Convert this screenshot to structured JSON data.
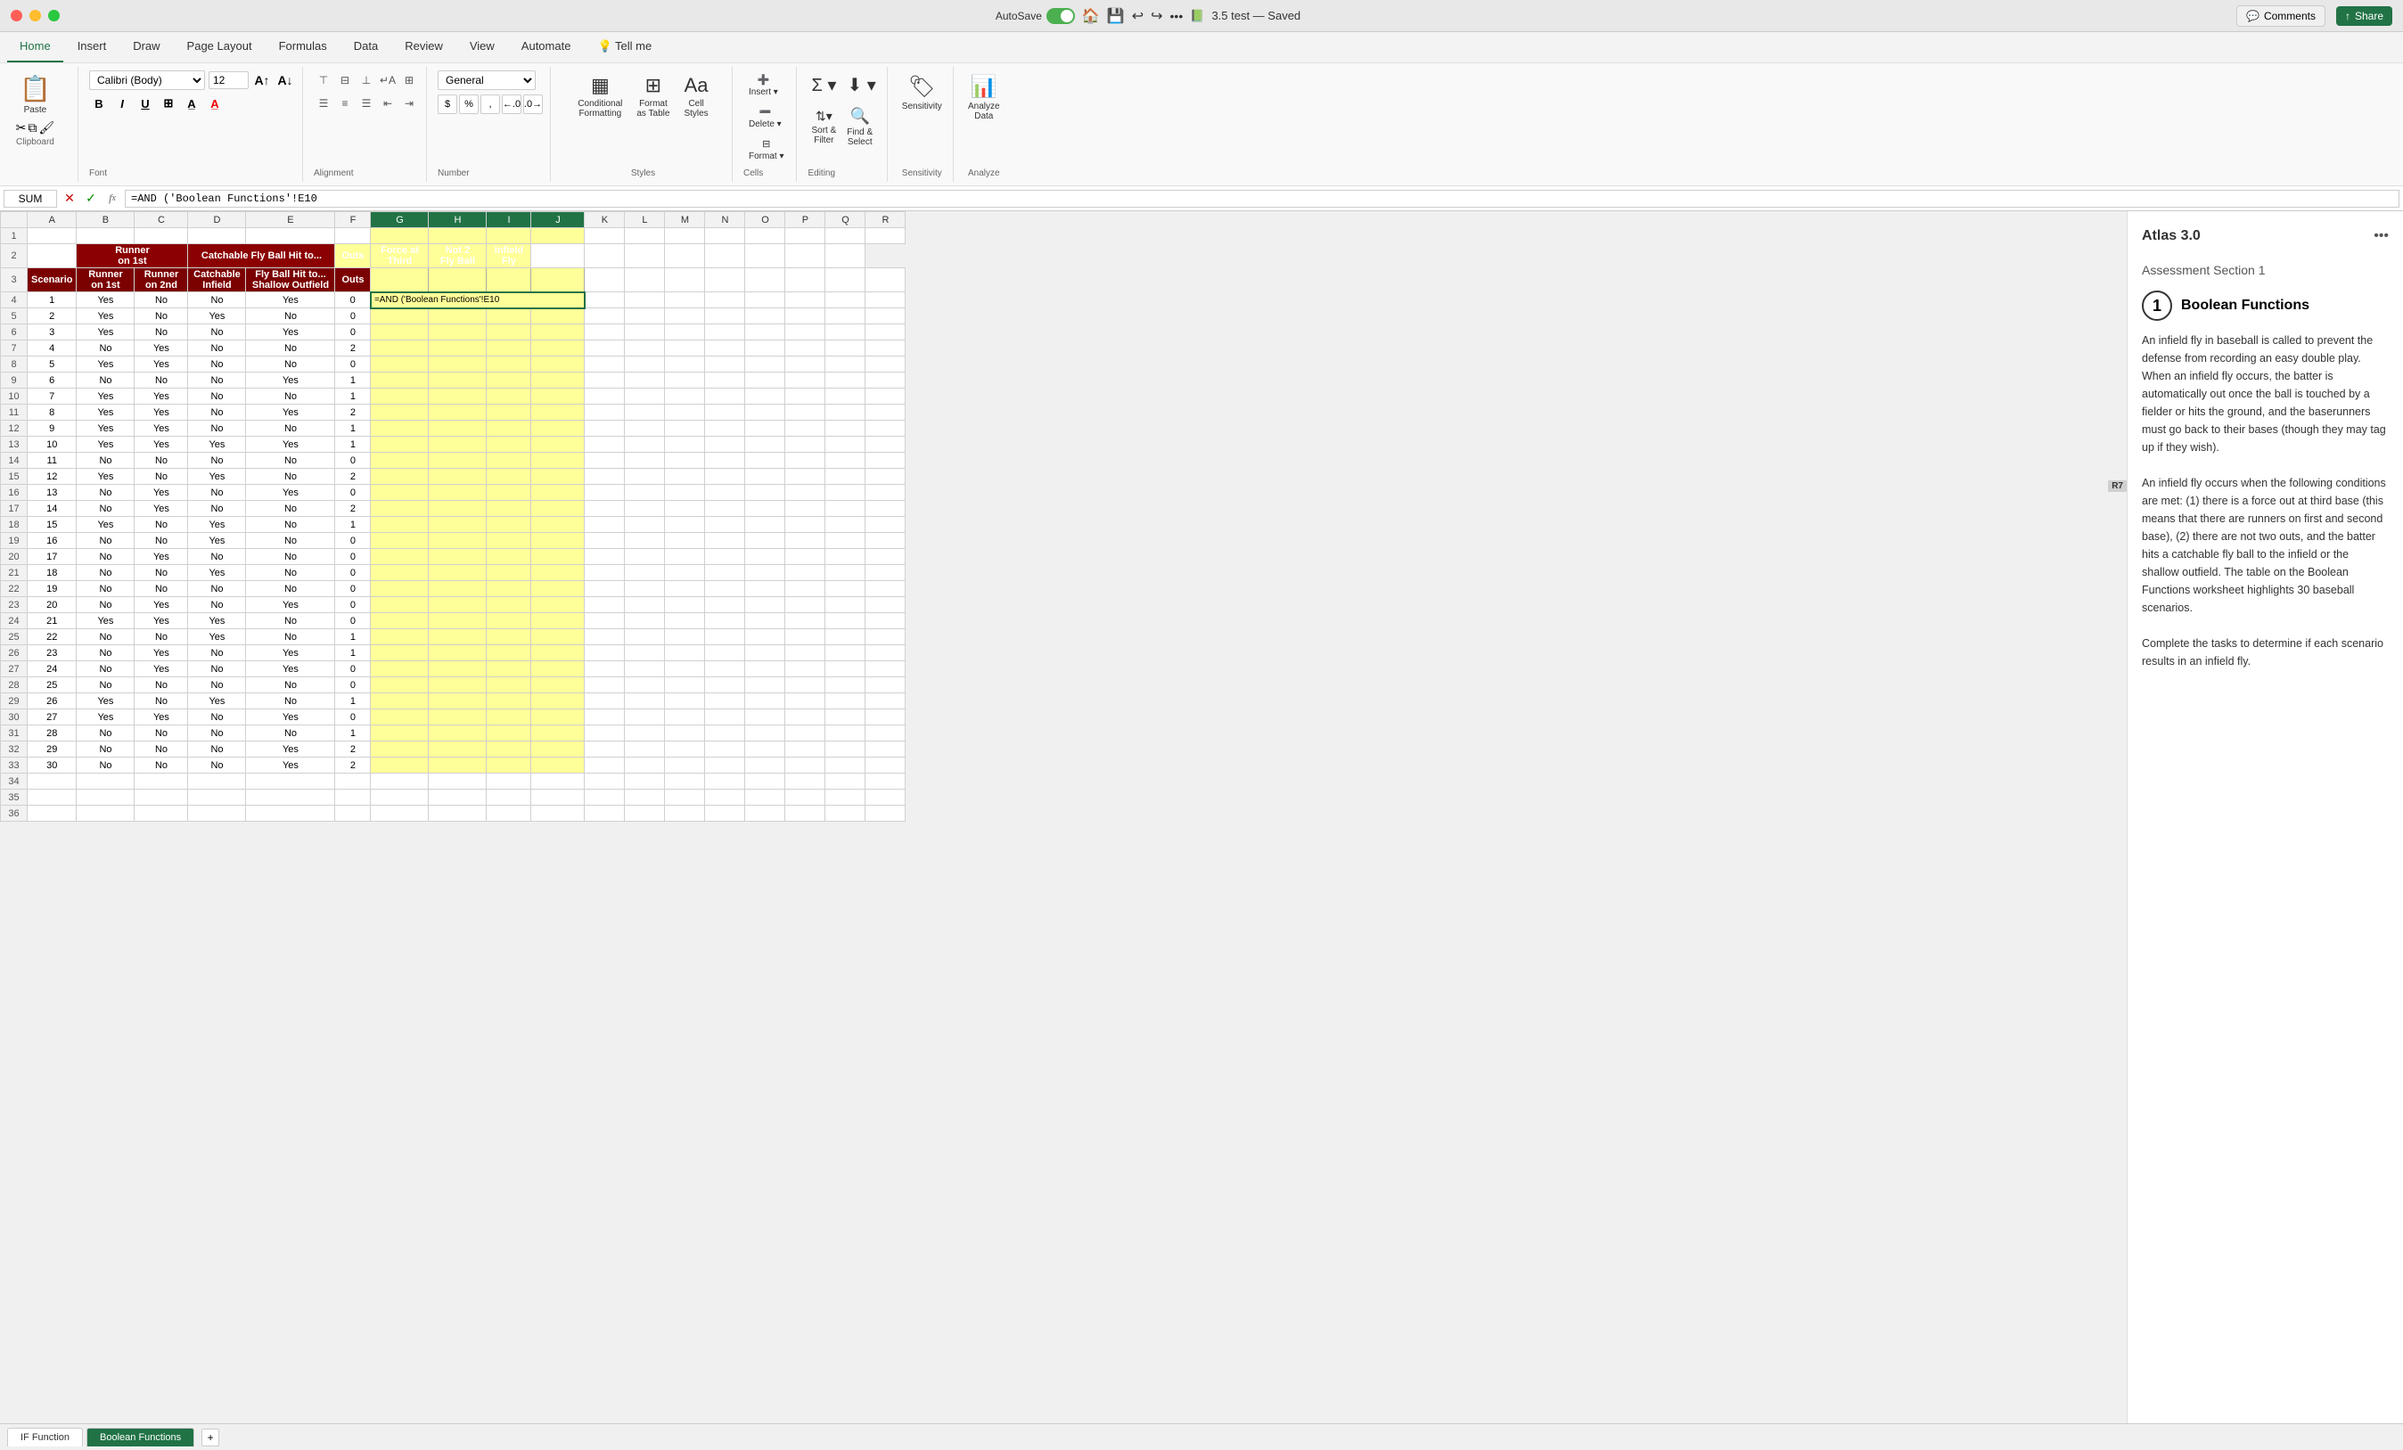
{
  "titleBar": {
    "autosave": "AutoSave",
    "title": "3.5 test — Saved",
    "comments": "Comments",
    "share": "Share"
  },
  "ribbon": {
    "tabs": [
      "Home",
      "Insert",
      "Draw",
      "Page Layout",
      "Formulas",
      "Data",
      "Review",
      "View",
      "Automate",
      "Tell me"
    ],
    "activeTab": "Home",
    "font": {
      "name": "Calibri (Body)",
      "size": "12"
    },
    "numberFormat": "General",
    "groups": {
      "clipboard": "Paste",
      "font": "Font",
      "alignment": "Alignment",
      "number": "Number",
      "styles": "Styles",
      "cells": "Cells",
      "editing": "Editing",
      "sensitivity": "Sensitivity",
      "analyze": "Analyze Data"
    },
    "conditionalFormatting": "Conditional\nFormatting",
    "formatAsTable": "Format\nas Table",
    "cellStyles": "Cell\nStyles",
    "insert": "Insert",
    "delete": "Delete",
    "format": "Format",
    "sortFilter": "Sort &\nFilter",
    "findSelect": "Find &\nSelect",
    "sensitivity": "Sensitivity",
    "analyzeData": "Analyze\nData"
  },
  "formulaBar": {
    "nameBox": "SUM",
    "formula": "=AND ('Boolean Functions'!E10"
  },
  "spreadsheet": {
    "activeCell": "H4",
    "columns": [
      "",
      "A",
      "B",
      "C",
      "D",
      "E",
      "F",
      "G",
      "H",
      "I",
      "J",
      "K",
      "L",
      "M",
      "N",
      "O",
      "P",
      "Q",
      "R"
    ],
    "headers": {
      "row2": [
        "",
        "",
        "Runner on 1st",
        "Runner on 2nd",
        "Catchable Infield",
        "Fly Ball Hit to... Shallow Outfield",
        "Outs",
        "Force at Third",
        "Not 2 Fly Ball",
        "Infield Fly",
        "",
        "",
        "",
        "",
        "",
        "",
        "",
        "",
        ""
      ],
      "row3": [
        "",
        "Scenario",
        "Runner on 1st",
        "Runner on 2nd",
        "Catchable Infield",
        "Shallow Outfield",
        "Outs",
        "Force at Third",
        "Not 2 Fly Ball",
        "Infield Fly",
        "",
        "",
        "",
        "",
        "",
        "",
        "",
        "",
        ""
      ]
    },
    "rows": [
      {
        "num": 1,
        "cols": [
          1,
          "Yes",
          "No",
          "No",
          "Yes",
          "",
          0,
          "",
          "",
          "",
          "",
          "",
          "",
          "",
          "",
          "",
          "",
          ""
        ]
      },
      {
        "num": 2,
        "cols": [
          2,
          "Yes",
          "No",
          "Yes",
          "No",
          "",
          0,
          "",
          "",
          "",
          "",
          "",
          "",
          "",
          "",
          "",
          "",
          ""
        ]
      },
      {
        "num": 3,
        "cols": [
          3,
          "Yes",
          "No",
          "No",
          "Yes",
          "",
          0,
          "",
          "",
          "",
          "",
          "",
          "",
          "",
          "",
          "",
          "",
          ""
        ]
      },
      {
        "num": 4,
        "cols": [
          4,
          "No",
          "Yes",
          "No",
          "No",
          "",
          2,
          "",
          "",
          "",
          "",
          "",
          "",
          "",
          "",
          "",
          "",
          ""
        ]
      },
      {
        "num": 5,
        "cols": [
          5,
          "Yes",
          "Yes",
          "No",
          "No",
          "",
          0,
          "",
          "",
          "",
          "",
          "",
          "",
          "",
          "",
          "",
          "",
          ""
        ]
      },
      {
        "num": 6,
        "cols": [
          6,
          "No",
          "No",
          "No",
          "Yes",
          "",
          1,
          "",
          "",
          "",
          "",
          "",
          "",
          "",
          "",
          "",
          "",
          ""
        ]
      },
      {
        "num": 7,
        "cols": [
          7,
          "Yes",
          "Yes",
          "No",
          "No",
          "",
          1,
          "",
          "",
          "",
          "",
          "",
          "",
          "",
          "",
          "",
          "",
          ""
        ]
      },
      {
        "num": 8,
        "cols": [
          8,
          "Yes",
          "Yes",
          "No",
          "Yes",
          "",
          2,
          "",
          "",
          "",
          "",
          "",
          "",
          "",
          "",
          "",
          "",
          ""
        ]
      },
      {
        "num": 9,
        "cols": [
          9,
          "Yes",
          "Yes",
          "No",
          "No",
          "",
          1,
          "",
          "",
          "",
          "",
          "",
          "",
          "",
          "",
          "",
          "",
          ""
        ]
      },
      {
        "num": 10,
        "cols": [
          10,
          "Yes",
          "Yes",
          "Yes",
          "Yes",
          "",
          1,
          "",
          "",
          "",
          "",
          "",
          "",
          "",
          "",
          "",
          "",
          ""
        ]
      },
      {
        "num": 11,
        "cols": [
          11,
          "No",
          "No",
          "No",
          "No",
          "",
          0,
          "",
          "",
          "",
          "",
          "",
          "",
          "",
          "",
          "",
          "",
          ""
        ]
      },
      {
        "num": 12,
        "cols": [
          12,
          "Yes",
          "No",
          "Yes",
          "No",
          "",
          2,
          "",
          "",
          "",
          "",
          "",
          "",
          "",
          "",
          "",
          "",
          ""
        ]
      },
      {
        "num": 13,
        "cols": [
          13,
          "No",
          "Yes",
          "No",
          "Yes",
          "",
          0,
          "",
          "",
          "",
          "",
          "",
          "",
          "",
          "",
          "",
          "",
          ""
        ]
      },
      {
        "num": 14,
        "cols": [
          14,
          "No",
          "Yes",
          "No",
          "No",
          "",
          2,
          "",
          "",
          "",
          "",
          "",
          "",
          "",
          "",
          "",
          "",
          ""
        ]
      },
      {
        "num": 15,
        "cols": [
          15,
          "Yes",
          "No",
          "Yes",
          "No",
          "",
          1,
          "",
          "",
          "",
          "",
          "",
          "",
          "",
          "",
          "",
          "",
          ""
        ]
      },
      {
        "num": 16,
        "cols": [
          16,
          "No",
          "No",
          "Yes",
          "No",
          "",
          0,
          "",
          "",
          "",
          "",
          "",
          "",
          "",
          "",
          "",
          "",
          ""
        ]
      },
      {
        "num": 17,
        "cols": [
          17,
          "No",
          "Yes",
          "No",
          "No",
          "",
          0,
          "",
          "",
          "",
          "",
          "",
          "",
          "",
          "",
          "",
          "",
          ""
        ]
      },
      {
        "num": 18,
        "cols": [
          18,
          "No",
          "No",
          "Yes",
          "No",
          "",
          0,
          "",
          "",
          "",
          "",
          "",
          "",
          "",
          "",
          "",
          "",
          ""
        ]
      },
      {
        "num": 19,
        "cols": [
          19,
          "No",
          "No",
          "No",
          "No",
          "",
          0,
          "",
          "",
          "",
          "",
          "",
          "",
          "",
          "",
          "",
          "",
          ""
        ]
      },
      {
        "num": 20,
        "cols": [
          20,
          "No",
          "Yes",
          "No",
          "Yes",
          "",
          0,
          "",
          "",
          "",
          "",
          "",
          "",
          "",
          "",
          "",
          "",
          ""
        ]
      },
      {
        "num": 21,
        "cols": [
          21,
          "Yes",
          "Yes",
          "Yes",
          "No",
          "",
          0,
          "",
          "",
          "",
          "",
          "",
          "",
          "",
          "",
          "",
          "",
          ""
        ]
      },
      {
        "num": 22,
        "cols": [
          22,
          "No",
          "No",
          "Yes",
          "No",
          "",
          1,
          "",
          "",
          "",
          "",
          "",
          "",
          "",
          "",
          "",
          "",
          ""
        ]
      },
      {
        "num": 23,
        "cols": [
          23,
          "No",
          "Yes",
          "No",
          "Yes",
          "",
          1,
          "",
          "",
          "",
          "",
          "",
          "",
          "",
          "",
          "",
          "",
          ""
        ]
      },
      {
        "num": 24,
        "cols": [
          24,
          "No",
          "Yes",
          "No",
          "Yes",
          "",
          0,
          "",
          "",
          "",
          "",
          "",
          "",
          "",
          "",
          "",
          "",
          ""
        ]
      },
      {
        "num": 25,
        "cols": [
          25,
          "No",
          "No",
          "No",
          "No",
          "",
          0,
          "",
          "",
          "",
          "",
          "",
          "",
          "",
          "",
          "",
          "",
          ""
        ]
      },
      {
        "num": 26,
        "cols": [
          26,
          "Yes",
          "No",
          "Yes",
          "No",
          "",
          1,
          "",
          "",
          "",
          "",
          "",
          "",
          "",
          "",
          "",
          "",
          ""
        ]
      },
      {
        "num": 27,
        "cols": [
          27,
          "Yes",
          "Yes",
          "No",
          "Yes",
          "",
          0,
          "",
          "",
          "",
          "",
          "",
          "",
          "",
          "",
          "",
          "",
          ""
        ]
      },
      {
        "num": 28,
        "cols": [
          28,
          "No",
          "No",
          "No",
          "No",
          "",
          1,
          "",
          "",
          "",
          "",
          "",
          "",
          "",
          "",
          "",
          "",
          ""
        ]
      },
      {
        "num": 29,
        "cols": [
          29,
          "No",
          "No",
          "No",
          "Yes",
          "",
          2,
          "",
          "",
          "",
          "",
          "",
          "",
          "",
          "",
          "",
          "",
          ""
        ]
      },
      {
        "num": 30,
        "cols": [
          30,
          "No",
          "No",
          "No",
          "Yes",
          "",
          2,
          "",
          "",
          "",
          "",
          "",
          "",
          "",
          "",
          "",
          "",
          ""
        ]
      }
    ]
  },
  "sidePanel": {
    "atlasTitle": "Atlas 3.0",
    "assessmentSection": "Assessment Section 1",
    "taskNumber": "1",
    "taskTitle": "Boolean Functions",
    "taskBody": "An infield fly in baseball is called to prevent the defense from recording an easy double play. When an infield fly occurs, the batter is automatically out once the ball is touched by a fielder or hits the ground, and the baserunners must go back to their bases (though they may tag up if they wish).\nAn infield fly occurs when the following conditions are met: (1) there is a force out at third base (this means that there are runners on first and second base), (2) there are not two outs, and the batter hits a catchable fly ball to the infield or the shallow outfield. The table on the Boolean Functions worksheet highlights 30 baseball scenarios.\n\nComplete the tasks to determine if each scenario results in an infield fly."
  },
  "sheets": [
    "IF Function",
    "Boolean Functions"
  ]
}
